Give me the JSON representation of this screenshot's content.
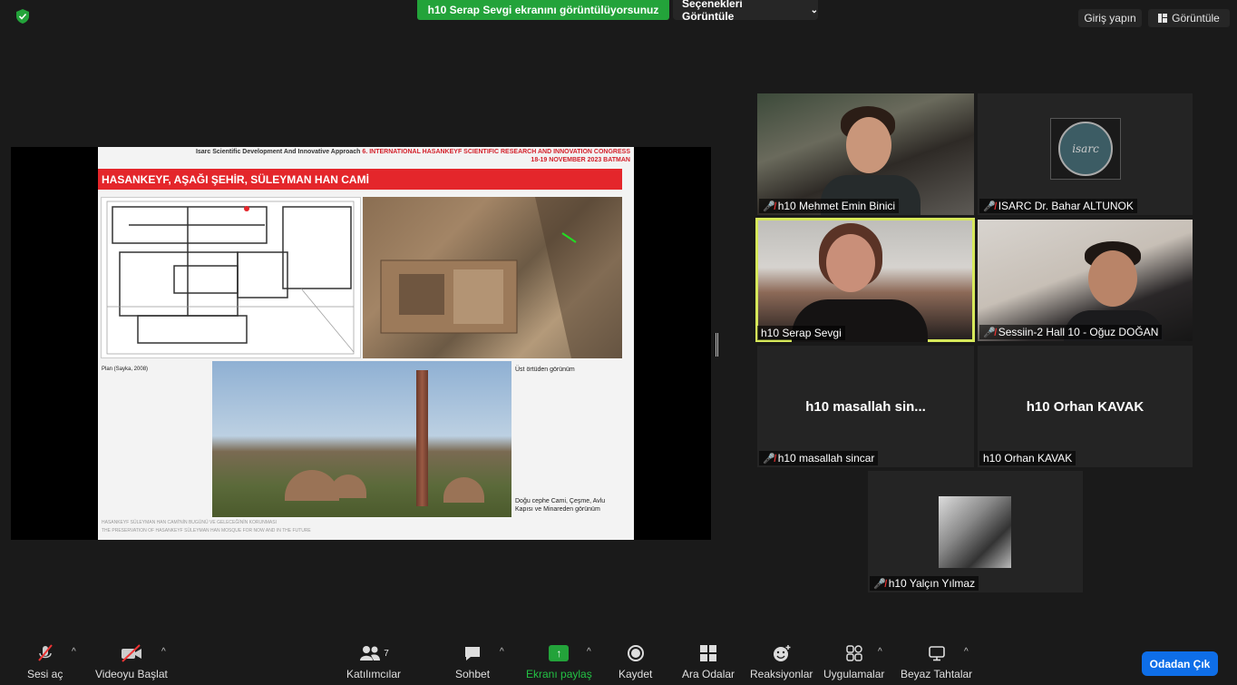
{
  "top_bar": {
    "share_banner": "h10 Serap Sevgi ekranını görüntülüyorsunuz",
    "view_options": "Seçenekleri Görüntüle",
    "signin": "Giriş yapın",
    "view": "Görüntüle"
  },
  "slide": {
    "header_black": "Isarc Scientific Development And Innovative Approach",
    "header_red": "6. INTERNATIONAL HASANKEYF SCIENTIFIC RESEARCH AND INNOVATION CONGRESS",
    "header_date": "18-19 NOVEMBER 2023 BATMAN",
    "title": "HASANKEYF, AŞAĞI ŞEHİR, SÜLEYMAN HAN CAMİ",
    "plan_label": "Plan (Sayka, 2008)",
    "top_view_label": "Üst örtüden görünüm",
    "east_label": "Doğu cephe Cami, Çeşme, Avlu Kapısı ve Minareden görünüm",
    "footer_tr": "HASANKEYF SÜLEYMAN HAN CAMİ'NİN BUGÜNÜ VE GELECEĞİNİN KORUNMASI",
    "footer_en": "THE PRESERVATION OF HASANKEYF SÜLEYMAN HAN MOSQUE FOR NOW AND IN THE FUTURE"
  },
  "participants": [
    {
      "name": "h10 Mehmet Emin Binici",
      "muted": true
    },
    {
      "name": "ISARC Dr. Bahar ALTUNOK",
      "muted": true,
      "logo_text": "isarc"
    },
    {
      "name": "h10 Serap Sevgi",
      "muted": false
    },
    {
      "name": "Sessiin-2 Hall 10 - Oğuz DOĞAN",
      "muted": true
    },
    {
      "name": "h10 masallah sincar",
      "muted": true,
      "display": "h10 masallah sin..."
    },
    {
      "name": "h10 Orhan KAVAK",
      "muted": false,
      "display": "h10 Orhan KAVAK"
    },
    {
      "name": "h10 Yalçın Yılmaz",
      "muted": true
    }
  ],
  "toolbar": {
    "audio": "Sesi aç",
    "video": "Videoyu Başlat",
    "participants": "Katılımcılar",
    "participants_count": "7",
    "chat": "Sohbet",
    "share": "Ekranı paylaş",
    "record": "Kaydet",
    "breakout": "Ara Odalar",
    "reactions": "Reaksiyonlar",
    "apps": "Uygulamalar",
    "whiteboard": "Beyaz Tahtalar",
    "leave": "Odadan Çık"
  },
  "colors": {
    "share_green": "#23a33a",
    "leave_blue": "#0e6ee8",
    "active_speaker": "#d6e85a",
    "slide_red": "#e4262b"
  }
}
